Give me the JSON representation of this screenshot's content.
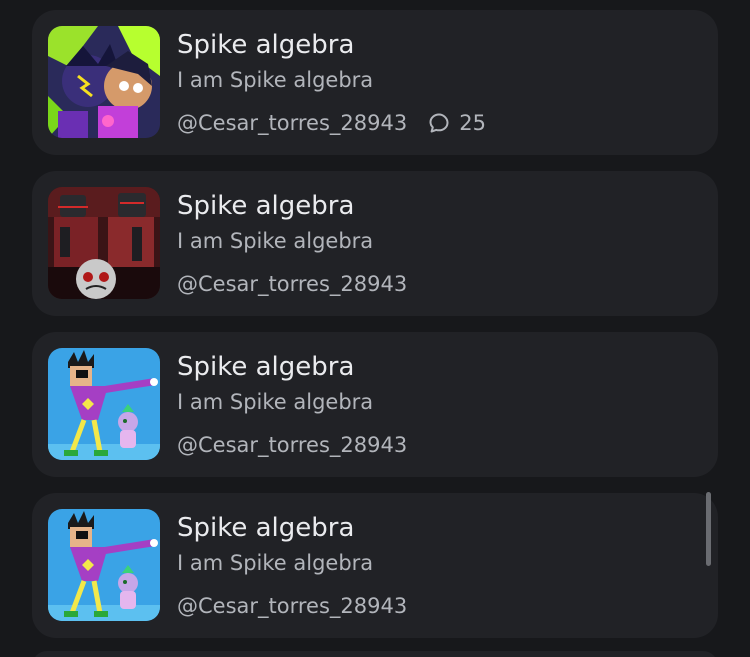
{
  "items": [
    {
      "title": "Spike algebra",
      "description": "I am Spike algebra",
      "author": "@Cesar_torres_28943",
      "comments": "25",
      "avatar": "dark-neon-characters-art"
    },
    {
      "title": "Spike algebra",
      "description": "I am Spike algebra",
      "author": "@Cesar_torres_28943",
      "avatar": "red-robot-characters-art"
    },
    {
      "title": "Spike algebra",
      "description": "I am Spike algebra",
      "author": "@Cesar_torres_28943",
      "avatar": "purple-figure-blue-sky-art"
    },
    {
      "title": "Spike algebra",
      "description": "I am Spike algebra",
      "author": "@Cesar_torres_28943",
      "avatar": "purple-figure-blue-sky-art"
    }
  ],
  "icons": {
    "comment": "comment-icon"
  },
  "colors": {
    "background": "#17181b",
    "card": "#212226",
    "title": "#eaebee",
    "secondary_text": "#b2b5bb",
    "scrollbar": "#6a6c71"
  }
}
